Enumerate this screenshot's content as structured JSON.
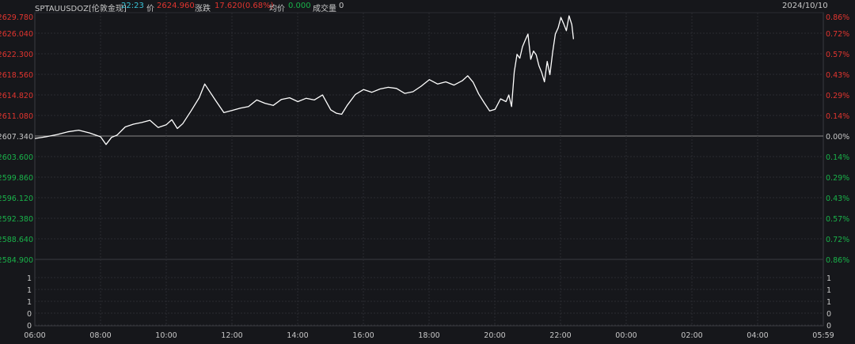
{
  "header": {
    "symbol": "SPTAUUSDOZ[伦敦金现]",
    "time": "22:23",
    "price_label": "价",
    "price": "2624.960",
    "change_label": "涨跌",
    "change": "17.620(0.68%)",
    "avg_label": "均价",
    "avg": "0.000",
    "volume_label": "成交量",
    "volume": "0",
    "date": "2024/10/10"
  },
  "colors": {
    "background": "#16171b",
    "up": "#e2352f",
    "down": "#19b34a",
    "neutral": "#c8c8c8",
    "price_line": "#ffffff",
    "time_highlight": "#39c3d6"
  },
  "chart_data": {
    "type": "line",
    "prev_close": 2607.34,
    "ylim": [
      2584.9,
      2629.78
    ],
    "left_ticks": [
      "2629.780",
      "2626.040",
      "2622.300",
      "2618.560",
      "2614.820",
      "2611.080",
      "2607.340",
      "2603.600",
      "2599.860",
      "2596.120",
      "2592.380",
      "2588.640",
      "2584.900"
    ],
    "right_ticks": [
      "0.86%",
      "0.72%",
      "0.57%",
      "0.43%",
      "0.29%",
      "0.14%",
      "0.00%",
      "0.14%",
      "0.29%",
      "0.43%",
      "0.57%",
      "0.72%",
      "0.86%"
    ],
    "volume_ticks": [
      "1",
      "1",
      "1",
      "0",
      "0"
    ],
    "x_ticks": [
      "06:00",
      "08:00",
      "10:00",
      "12:00",
      "14:00",
      "16:00",
      "18:00",
      "20:00",
      "22:00",
      "00:00",
      "02:00",
      "04:00",
      "05:59"
    ],
    "series": [
      {
        "x": [
          "06:00",
          "06:20",
          "06:40",
          "07:00",
          "07:20",
          "07:40",
          "08:00",
          "08:10",
          "08:20",
          "08:30",
          "08:45",
          "09:00",
          "09:15",
          "09:30",
          "09:45",
          "10:00",
          "10:10",
          "10:20",
          "10:30",
          "10:45",
          "11:00",
          "11:10",
          "11:20",
          "11:30",
          "11:45",
          "12:00",
          "12:15",
          "12:30",
          "12:45",
          "13:00",
          "13:15",
          "13:30",
          "13:45",
          "14:00",
          "14:15",
          "14:30",
          "14:45",
          "15:00",
          "15:10",
          "15:20",
          "15:30",
          "15:45",
          "16:00",
          "16:15",
          "16:30",
          "16:45",
          "17:00",
          "17:15",
          "17:30",
          "17:45",
          "18:00",
          "18:15",
          "18:30",
          "18:45",
          "19:00",
          "19:10",
          "19:20",
          "19:30",
          "19:40",
          "19:50",
          "20:00",
          "20:10",
          "20:20",
          "20:25",
          "20:30",
          "20:35",
          "20:40",
          "20:45",
          "20:50",
          "20:55",
          "21:00",
          "21:05",
          "21:10",
          "21:15",
          "21:20",
          "21:25",
          "21:30",
          "21:35",
          "21:40",
          "21:45",
          "21:50",
          "21:55",
          "22:00",
          "22:05",
          "22:10",
          "22:15",
          "22:20",
          "22:23"
        ],
        "y": [
          2606.9,
          2607.2,
          2607.6,
          2608.1,
          2608.4,
          2607.9,
          2607.2,
          2605.8,
          2607.1,
          2607.5,
          2609.0,
          2609.5,
          2609.8,
          2610.2,
          2608.9,
          2609.4,
          2610.3,
          2608.7,
          2609.6,
          2611.9,
          2614.3,
          2616.8,
          2615.3,
          2613.8,
          2611.6,
          2612.0,
          2612.4,
          2612.7,
          2613.9,
          2613.3,
          2612.9,
          2614.0,
          2614.3,
          2613.6,
          2614.2,
          2613.9,
          2614.8,
          2612.1,
          2611.5,
          2611.3,
          2612.9,
          2614.9,
          2615.8,
          2615.3,
          2615.9,
          2616.2,
          2616.0,
          2615.1,
          2615.4,
          2616.4,
          2617.6,
          2616.8,
          2617.2,
          2616.6,
          2617.4,
          2618.3,
          2617.1,
          2615.0,
          2613.4,
          2611.9,
          2612.2,
          2614.1,
          2613.6,
          2614.8,
          2612.7,
          2619.0,
          2622.2,
          2621.5,
          2623.6,
          2624.8,
          2625.9,
          2621.3,
          2622.8,
          2622.1,
          2620.1,
          2618.9,
          2617.2,
          2620.9,
          2618.5,
          2622.6,
          2625.9,
          2627.0,
          2628.9,
          2627.8,
          2626.5,
          2629.2,
          2627.6,
          2624.96
        ]
      }
    ]
  }
}
